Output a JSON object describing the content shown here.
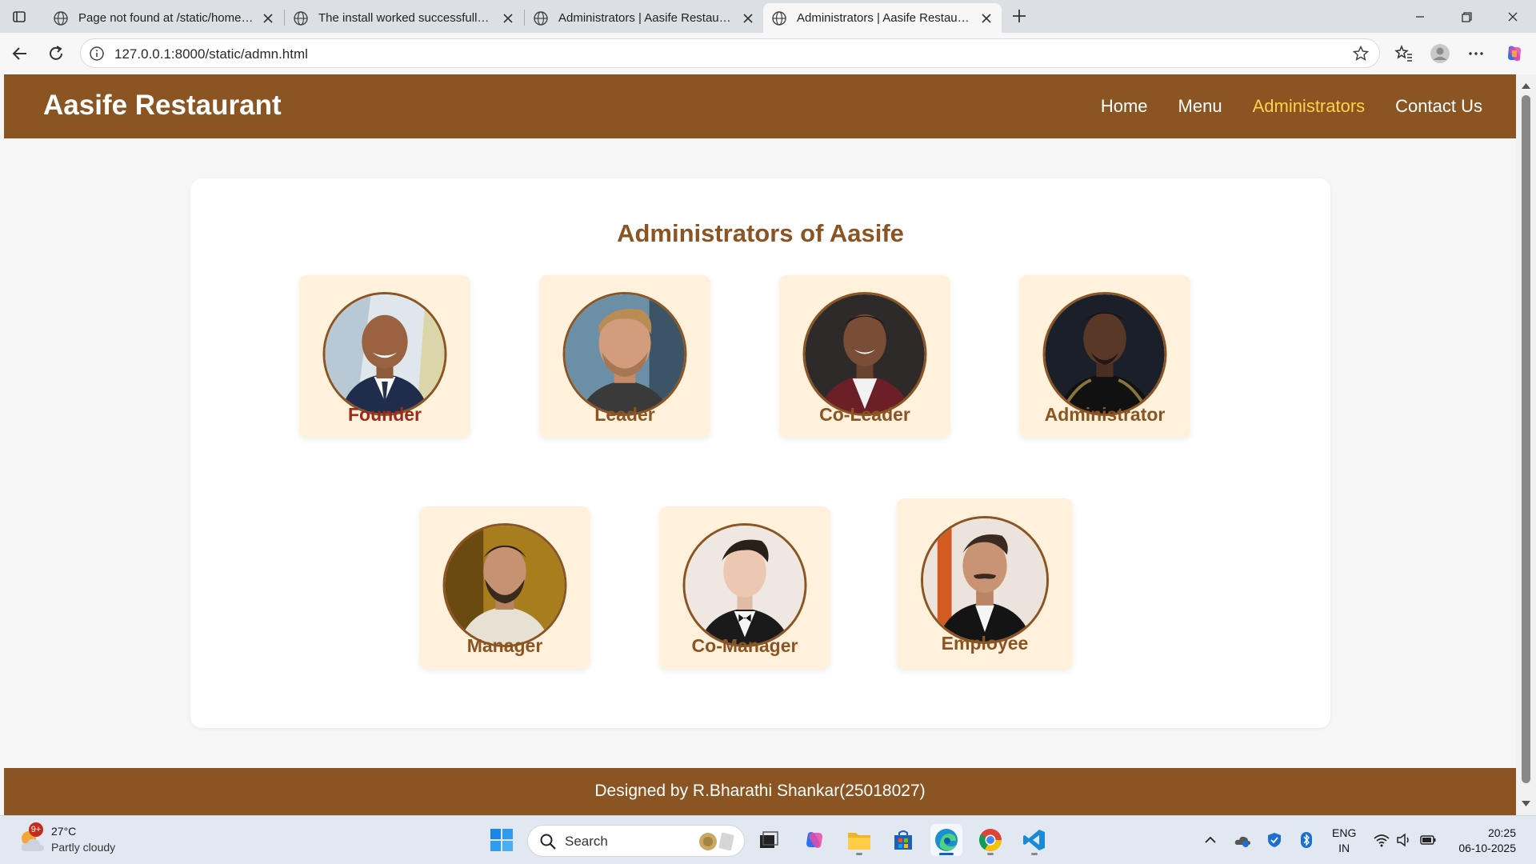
{
  "browser": {
    "tabs": [
      {
        "title": "Page not found at /static/home.html",
        "active": false
      },
      {
        "title": "The install worked successfully! Congratulations!",
        "active": false
      },
      {
        "title": "Administrators | Aasife Restaurant",
        "active": false
      },
      {
        "title": "Administrators | Aasife Restaurant",
        "active": true
      }
    ],
    "url": "127.0.0.1:8000/static/admn.html"
  },
  "site": {
    "brand": "Aasife Restaurant",
    "nav": [
      {
        "label": "Home",
        "active": false
      },
      {
        "label": "Menu",
        "active": false
      },
      {
        "label": "Administrators",
        "active": true
      },
      {
        "label": "Contact Us",
        "active": false
      }
    ],
    "section_title": "Administrators of Aasife",
    "admins": [
      {
        "role": "Founder",
        "photo": "man-smiling-navy-suit-photo"
      },
      {
        "role": "Leader",
        "photo": "man-blond-beard-photo"
      },
      {
        "role": "Co-Leader",
        "photo": "man-smiling-maroon-suit-photo"
      },
      {
        "role": "Administrator",
        "photo": "man-black-jacket-photo"
      },
      {
        "role": "Manager",
        "photo": "man-beard-white-shirt-photo"
      },
      {
        "role": "Co-Manager",
        "photo": "man-tuxedo-photo"
      },
      {
        "role": "Employee",
        "photo": "man-mustache-black-suit-photo"
      }
    ],
    "footer": "Designed by R.Bharathi Shankar(25018027)"
  },
  "taskbar": {
    "weather": {
      "temp": "27°C",
      "condition": "Partly cloudy",
      "badge": "9+"
    },
    "search_label": "Search",
    "lang": {
      "line1": "ENG",
      "line2": "IN"
    },
    "clock": {
      "time": "20:25",
      "date": "06-10-2025"
    }
  },
  "colors": {
    "brand_brown": "#8b5423",
    "nav_active": "#ffd24a",
    "card_bg": "#fff1dc",
    "founder_label": "#9b2a1a"
  }
}
